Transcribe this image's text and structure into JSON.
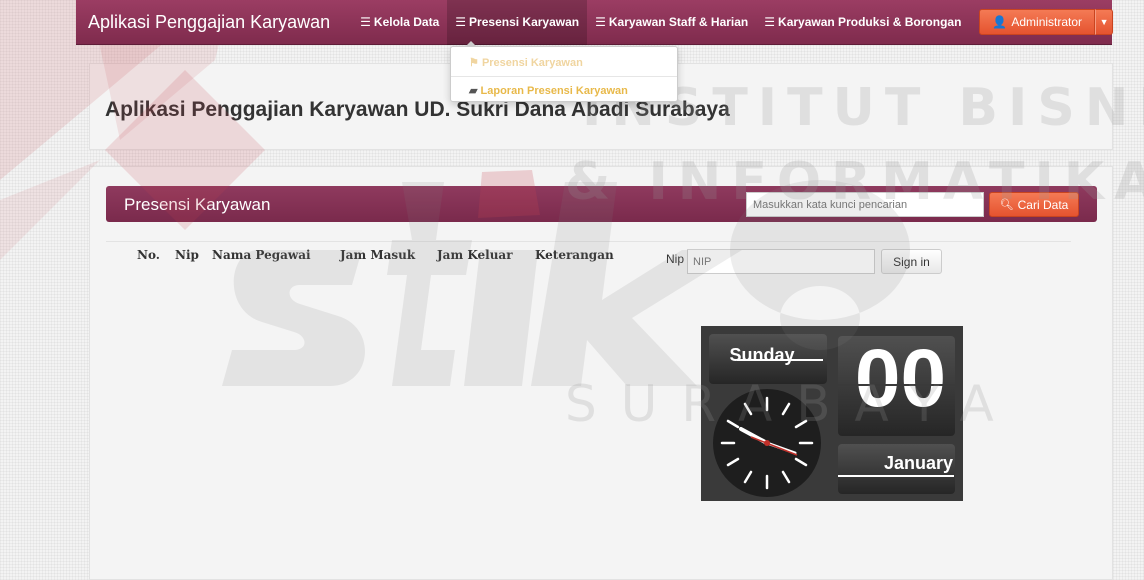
{
  "navbar": {
    "brand": "Aplikasi Penggajian Karyawan",
    "items": [
      {
        "label": "Kelola Data"
      },
      {
        "label": "Presensi Karyawan"
      },
      {
        "label": "Karyawan Staff & Harian"
      },
      {
        "label": "Karyawan Produksi & Borongan"
      }
    ],
    "user": "Administrator"
  },
  "dropdown": {
    "items": [
      {
        "label": "Presensi Karyawan"
      },
      {
        "label": "Laporan Presensi Karyawan"
      }
    ]
  },
  "page": {
    "title": "Aplikasi Penggajian Karyawan UD. Sukri Dana Abadi Surabaya"
  },
  "presensi": {
    "header": "Presensi Karyawan",
    "search_placeholder": "Masukkan kata kunci pencarian",
    "search_button": "Cari Data",
    "columns": [
      "No.",
      "Nip",
      "Nama Pegawai",
      "Jam Masuk",
      "Jam Keluar",
      "Keterangan"
    ],
    "nip_label": "Nip",
    "nip_placeholder": "NIP",
    "signin_button": "Sign in"
  },
  "clock": {
    "day": "Sunday",
    "date": "00",
    "month": "January"
  },
  "watermark": {
    "line1": "INSTITUT BISNIS",
    "line2": "& INFORMATIKA",
    "logo": "stikom",
    "city": "SURABAYA"
  },
  "colors": {
    "navbar": "#8b3458",
    "accent": "#e5532f",
    "dropdown_text": "#e8b94a"
  }
}
